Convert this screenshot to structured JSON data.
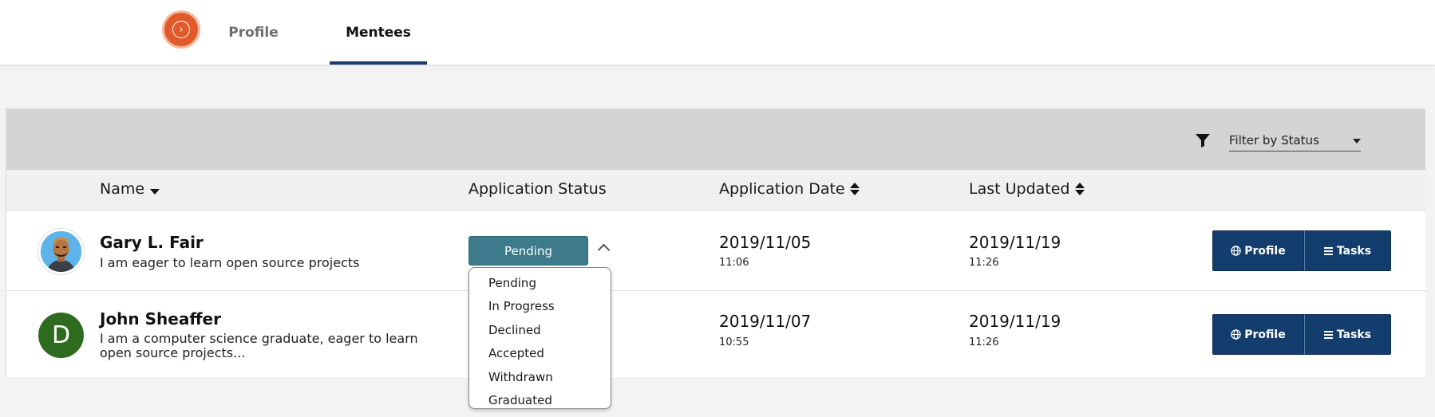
{
  "nav": {
    "tabs": [
      {
        "label": "Profile",
        "active": false
      },
      {
        "label": "Mentees",
        "active": true
      }
    ]
  },
  "filter": {
    "placeholder": "Filter by Status"
  },
  "table": {
    "headers": {
      "name": "Name",
      "status": "Application Status",
      "app_date": "Application Date",
      "last_updated": "Last Updated"
    },
    "rows": [
      {
        "name": "Gary L. Fair",
        "bio": "I am eager to learn open source projects",
        "avatar": "illustrated-person",
        "status": "Pending",
        "app_date": "2019/11/05",
        "app_time": "11:06",
        "updated_date": "2019/11/19",
        "updated_time": "11:26"
      },
      {
        "name": "John Sheaffer",
        "bio": "I am a computer science graduate, eager to learn open source projects...",
        "avatar_letter": "D",
        "app_date": "2019/11/07",
        "app_time": "10:55",
        "updated_date": "2019/11/19",
        "updated_time": "11:26"
      }
    ],
    "actions": {
      "profile_label": "Profile",
      "tasks_label": "Tasks"
    }
  },
  "status_options": [
    "Pending",
    "In Progress",
    "Declined",
    "Accepted",
    "Withdrawn",
    "Graduated"
  ],
  "colors": {
    "accent_orange": "#e05a2b",
    "primary_navy": "#123d6c",
    "status_teal": "#3c7a8c",
    "avatar_green": "#2f6b1f"
  }
}
